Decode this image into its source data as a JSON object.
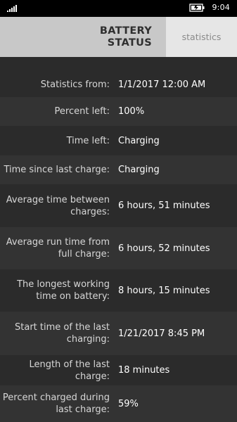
{
  "status_bar": {
    "time": "9:04",
    "signal_icon": "signal-icon",
    "battery_icon": "battery-icon"
  },
  "header": {
    "title_line1": "BATTERY",
    "title_line2": "STATUS",
    "tab_label": "statistics"
  },
  "stats": [
    {
      "label": "Statistics from:",
      "value": "1/1/2017 12:00 AM"
    },
    {
      "label": "Percent left:",
      "value": "100%"
    },
    {
      "label": "Time left:",
      "value": "Charging"
    },
    {
      "label": "Time since last charge:",
      "value": "Charging"
    },
    {
      "label": "Average time between charges:",
      "value": "6 hours, 51 minutes"
    },
    {
      "label": "Average run time from full charge:",
      "value": "6 hours, 52 minutes"
    },
    {
      "label": "The longest working time on battery:",
      "value": "8 hours, 15 minutes"
    },
    {
      "label": "Start time of the last charging:",
      "value": "1/21/2017 8:45 PM"
    },
    {
      "label": "Length of the last charge:",
      "value": "18 minutes"
    },
    {
      "label": "Percent charged during last charge:",
      "value": "59%"
    }
  ]
}
